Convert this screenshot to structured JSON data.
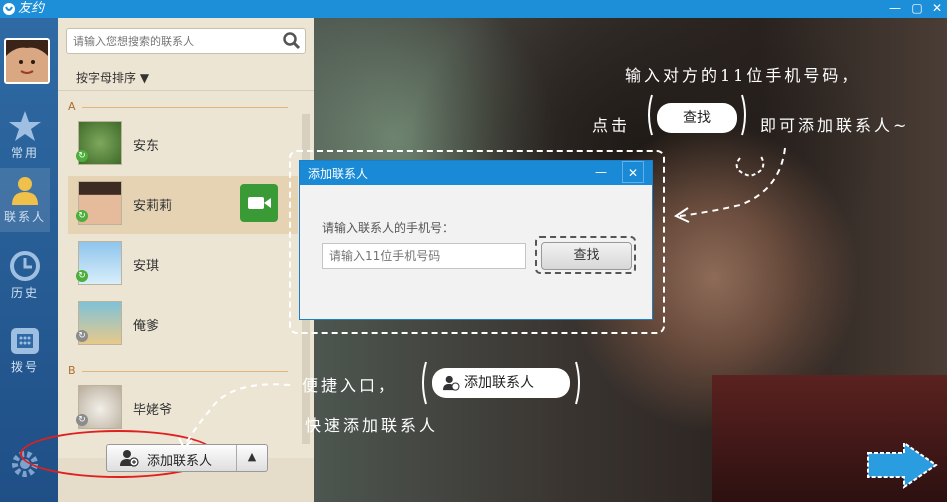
{
  "app": {
    "title": "友约"
  },
  "nav": [
    {
      "label": "常用",
      "icon": "star-icon"
    },
    {
      "label": "联系人",
      "icon": "person-icon"
    },
    {
      "label": "历史",
      "icon": "history-icon"
    },
    {
      "label": "拨号",
      "icon": "phone-icon"
    }
  ],
  "search": {
    "placeholder": "请输入您想搜索的联系人"
  },
  "sort": {
    "label": "按字母排序 ▼"
  },
  "groups": [
    {
      "letter": "A",
      "contacts": [
        "安东",
        "安莉莉",
        "安琪",
        "俺爹"
      ]
    },
    {
      "letter": "B",
      "contacts": [
        "毕姥爷"
      ]
    }
  ],
  "add_button": {
    "label": "添加联系人",
    "arrow": "▲"
  },
  "dialog": {
    "title": "添加联系人",
    "prompt": "请输入联系人的手机号：",
    "placeholder": "请输入11位手机号码",
    "find_label": "查找"
  },
  "tips": {
    "line1": "输入对方的11位手机号码，",
    "line2a": "点击",
    "find_pill": "查找",
    "line2b": "即可添加联系人~",
    "shortcut1": "便捷入口，",
    "add_pill": "添加联系人",
    "shortcut2": "快速添加联系人"
  },
  "colors": {
    "titlebar": "#1d8fd8",
    "online": "#4cae3b",
    "highlight": "#e02020"
  }
}
